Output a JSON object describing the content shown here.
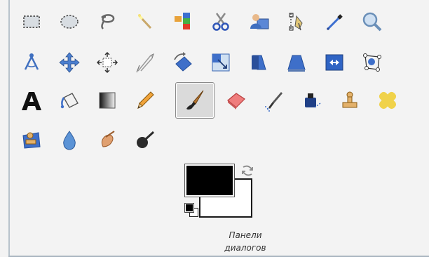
{
  "tools": [
    {
      "icon": "rect-select-icon"
    },
    {
      "icon": "ellipse-select-icon"
    },
    {
      "icon": "lasso-icon"
    },
    {
      "icon": "fuzzy-select-icon"
    },
    {
      "icon": "select-by-color-icon"
    },
    {
      "icon": "scissors-select-icon"
    },
    {
      "icon": "foreground-select-icon"
    },
    {
      "icon": "paths-icon"
    },
    {
      "icon": "color-picker-icon"
    },
    {
      "icon": "magnify-icon"
    },
    {
      "icon": "measure-icon"
    },
    {
      "icon": "move-icon"
    },
    {
      "icon": "align-icon"
    },
    {
      "icon": "crop-icon"
    },
    {
      "icon": "rotate-icon"
    },
    {
      "icon": "scale-icon"
    },
    {
      "icon": "shear-icon"
    },
    {
      "icon": "perspective-icon"
    },
    {
      "icon": "flip-icon"
    },
    {
      "icon": "cage-transform-icon"
    },
    {
      "icon": "text-icon"
    },
    {
      "icon": "bucket-fill-icon"
    },
    {
      "icon": "gradient-icon"
    },
    {
      "icon": "pencil-icon"
    },
    {
      "icon": "paintbrush-icon",
      "active": true
    },
    {
      "icon": "eraser-icon"
    },
    {
      "icon": "airbrush-icon"
    },
    {
      "icon": "ink-icon"
    },
    {
      "icon": "clone-icon"
    },
    {
      "icon": "heal-icon"
    },
    {
      "icon": "perspective-clone-icon"
    },
    {
      "icon": "blur-sharpen-icon"
    },
    {
      "icon": "smudge-icon"
    },
    {
      "icon": "dodge-burn-icon"
    }
  ],
  "colors": {
    "foreground": "#000000",
    "background": "#ffffff"
  },
  "caption": {
    "line1": "Панели",
    "line2": "диалогов"
  }
}
